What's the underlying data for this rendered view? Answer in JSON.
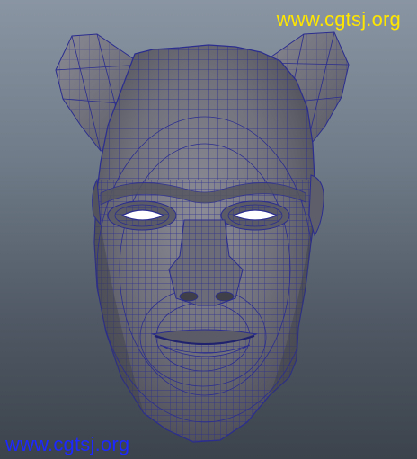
{
  "watermarks": {
    "top": "www.cgtsj.org",
    "bottom": "www.cgtsj.org"
  },
  "colors": {
    "top_watermark": "#ffe600",
    "bottom_watermark": "#1c28ff",
    "mesh_wire": "#2b2d8f",
    "mesh_fill_light": "#7d7d88",
    "mesh_fill_dark": "#4b4c55",
    "eye_highlight": "#ffffff"
  },
  "scene": {
    "object": "head-mesh",
    "display_mode": "wireframe-on-shaded"
  }
}
